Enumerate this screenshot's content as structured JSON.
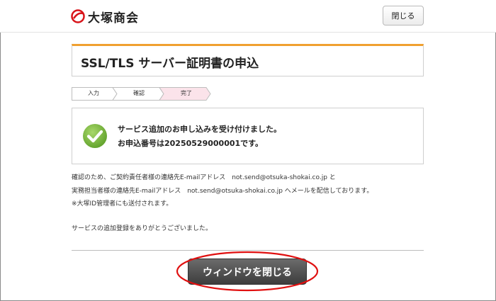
{
  "header": {
    "logo_text": "大塚商会",
    "close_label": "閉じる"
  },
  "title": "SSL/TLS サーバー証明書の申込",
  "steps": [
    {
      "label": "入力",
      "state": "done"
    },
    {
      "label": "確認",
      "state": "done"
    },
    {
      "label": "完了",
      "state": "current"
    }
  ],
  "completion": {
    "line1": "サービス追加のお申し込みを受け付けました。",
    "line2": "お申込番号は20250529000001です。"
  },
  "info": {
    "line1": "確認のため、ご契約責任者様の連絡先E-mailアドレス　not.send@otsuka-shokai.co.jp と",
    "line2": "実務担当者様の連絡先E-mailアドレス　not.send@otsuka-shokai.co.jp へメールを配信しております。",
    "line3": "※大塚ID管理者にも送付されます。",
    "line4": "サービスの追加登録をありがとうございました。"
  },
  "footer": {
    "close_window_label": "ウィンドウを閉じる"
  },
  "colors": {
    "accent_orange": "#f0a030",
    "current_step_bg": "#fbe3ea",
    "check_green": "#7ab840",
    "annotation_red": "#e01010"
  }
}
